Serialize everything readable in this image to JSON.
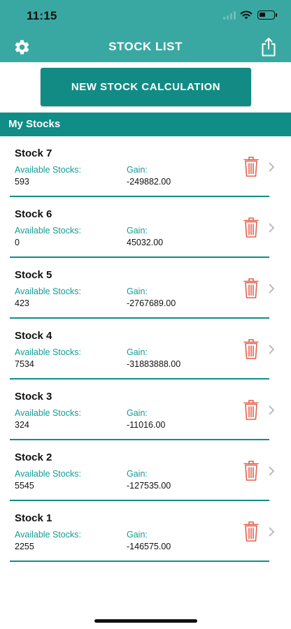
{
  "status_bar": {
    "time": "11:15"
  },
  "nav": {
    "title": "STOCK LIST",
    "settings_icon": "gear-icon",
    "share_icon": "share-icon"
  },
  "actions": {
    "new_calc_label": "NEW STOCK CALCULATION"
  },
  "section": {
    "title": "My Stocks"
  },
  "labels": {
    "available": "Available Stocks:",
    "gain": "Gain:"
  },
  "colors": {
    "header": "#3aa8a2",
    "accent": "#0f8d86",
    "label": "#129c94",
    "delete": "#e2614e"
  },
  "stocks": [
    {
      "name": "Stock 7",
      "available": "593",
      "gain": "-249882.00"
    },
    {
      "name": "Stock 6",
      "available": "0",
      "gain": "45032.00"
    },
    {
      "name": "Stock 5",
      "available": "423",
      "gain": "-2767689.00"
    },
    {
      "name": "Stock 4",
      "available": "7534",
      "gain": "-31883888.00"
    },
    {
      "name": "Stock 3",
      "available": "324",
      "gain": "-11016.00"
    },
    {
      "name": "Stock 2",
      "available": "5545",
      "gain": "-127535.00"
    },
    {
      "name": "Stock 1",
      "available": "2255",
      "gain": "-146575.00"
    }
  ]
}
